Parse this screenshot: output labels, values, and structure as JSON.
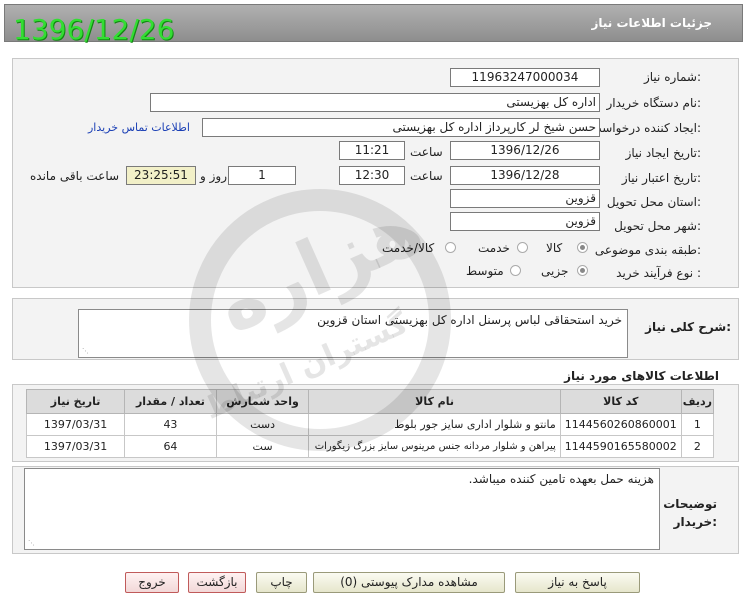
{
  "header": {
    "title": "جزئیات اطلاعات نیاز",
    "date_stamp": "1396/12/26"
  },
  "form": {
    "need_number": {
      "label": "شماره نیاز:",
      "value": "1196324700003​4"
    },
    "buyer_org": {
      "label": "نام دستگاه خریدار:",
      "value": "اداره کل بهزیستی"
    },
    "requester": {
      "label": "ایجاد کننده درخواست:",
      "value": "حسن شیخ لر کارپرداز اداره کل بهزیستی",
      "contact_link": "اطلاعات تماس خریدار"
    },
    "created": {
      "label": "تاریخ ایجاد نیاز:",
      "date": "1396/12/26",
      "time_label": "ساعت",
      "time": "11:21"
    },
    "validity": {
      "label": "تاریخ اعتبار نیاز:",
      "date": "1396/12/28",
      "time_label": "ساعت",
      "time": "12:30",
      "days": "1",
      "days_label": "روز و",
      "remaining": "23:25:51",
      "remaining_label": "ساعت باقی مانده"
    },
    "province": {
      "label": "استان محل تحویل:",
      "value": "قزوین"
    },
    "city": {
      "label": "شهر محل تحویل:",
      "value": "قزوین"
    },
    "category": {
      "label": "طبقه بندی موضوعی:",
      "options": [
        "کالا",
        "خدمت",
        "کالا/خدمت"
      ],
      "selected": "کالا"
    },
    "process": {
      "label": "نوع فرآیند خرید :",
      "options": [
        "جزیی",
        "متوسط"
      ],
      "selected": "جزیی"
    }
  },
  "description": {
    "label": "شرح کلی نیاز:",
    "value": "خرید استحقاقی لباس پرسنل اداره کل بهزیستی استان قزوین"
  },
  "goods": {
    "title": "اطلاعات کالاهای مورد نیاز",
    "columns": [
      "ردیف",
      "کد کالا",
      "نام کالا",
      "واحد شمارش",
      "تعداد / مقدار",
      "تاریخ نیاز"
    ],
    "rows": [
      [
        "1",
        "1144560260860001",
        "مانتو و شلوار اداری سایز جور بلوط",
        "دست",
        "43",
        "1397/03/31"
      ],
      [
        "2",
        "1144590165580002",
        "پیراهن و شلوار مردانه جنس مرینوس سایز بزرگ زیگورات",
        "ست",
        "64",
        "1397/03/31"
      ]
    ]
  },
  "notes": {
    "label_line1": "توضیحات",
    "label_line2": "خریدار:",
    "value": "هزینه حمل بعهده تامین کننده میباشد."
  },
  "buttons": {
    "reply": "پاسخ به نیاز",
    "attachments": "مشاهده مدارک پیوستی (0)",
    "print": "چاپ",
    "back": "بازگشت",
    "exit": "خروج"
  },
  "watermark": {
    "text1": "هزاره",
    "text2": "گستران ارتباط"
  },
  "colors": {
    "header_bg": "#9a9a9a",
    "date_green": "#33dd33",
    "link_blue": "#1a3fb5",
    "panel_bg": "#f3f3f3"
  }
}
